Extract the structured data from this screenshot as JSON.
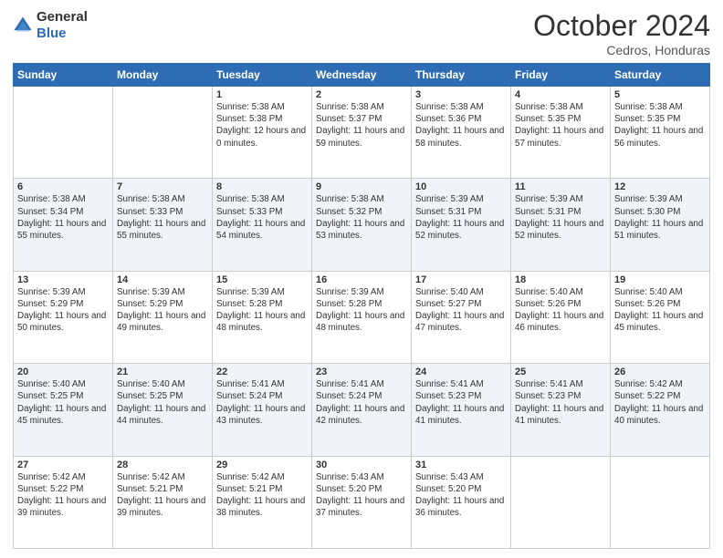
{
  "logo": {
    "general": "General",
    "blue": "Blue"
  },
  "header": {
    "month": "October 2024",
    "location": "Cedros, Honduras"
  },
  "days_of_week": [
    "Sunday",
    "Monday",
    "Tuesday",
    "Wednesday",
    "Thursday",
    "Friday",
    "Saturday"
  ],
  "weeks": [
    [
      {
        "day": null
      },
      {
        "day": null
      },
      {
        "day": "1",
        "sunrise": "Sunrise: 5:38 AM",
        "sunset": "Sunset: 5:38 PM",
        "daylight": "Daylight: 12 hours and 0 minutes."
      },
      {
        "day": "2",
        "sunrise": "Sunrise: 5:38 AM",
        "sunset": "Sunset: 5:37 PM",
        "daylight": "Daylight: 11 hours and 59 minutes."
      },
      {
        "day": "3",
        "sunrise": "Sunrise: 5:38 AM",
        "sunset": "Sunset: 5:36 PM",
        "daylight": "Daylight: 11 hours and 58 minutes."
      },
      {
        "day": "4",
        "sunrise": "Sunrise: 5:38 AM",
        "sunset": "Sunset: 5:35 PM",
        "daylight": "Daylight: 11 hours and 57 minutes."
      },
      {
        "day": "5",
        "sunrise": "Sunrise: 5:38 AM",
        "sunset": "Sunset: 5:35 PM",
        "daylight": "Daylight: 11 hours and 56 minutes."
      }
    ],
    [
      {
        "day": "6",
        "sunrise": "Sunrise: 5:38 AM",
        "sunset": "Sunset: 5:34 PM",
        "daylight": "Daylight: 11 hours and 55 minutes."
      },
      {
        "day": "7",
        "sunrise": "Sunrise: 5:38 AM",
        "sunset": "Sunset: 5:33 PM",
        "daylight": "Daylight: 11 hours and 55 minutes."
      },
      {
        "day": "8",
        "sunrise": "Sunrise: 5:38 AM",
        "sunset": "Sunset: 5:33 PM",
        "daylight": "Daylight: 11 hours and 54 minutes."
      },
      {
        "day": "9",
        "sunrise": "Sunrise: 5:38 AM",
        "sunset": "Sunset: 5:32 PM",
        "daylight": "Daylight: 11 hours and 53 minutes."
      },
      {
        "day": "10",
        "sunrise": "Sunrise: 5:39 AM",
        "sunset": "Sunset: 5:31 PM",
        "daylight": "Daylight: 11 hours and 52 minutes."
      },
      {
        "day": "11",
        "sunrise": "Sunrise: 5:39 AM",
        "sunset": "Sunset: 5:31 PM",
        "daylight": "Daylight: 11 hours and 52 minutes."
      },
      {
        "day": "12",
        "sunrise": "Sunrise: 5:39 AM",
        "sunset": "Sunset: 5:30 PM",
        "daylight": "Daylight: 11 hours and 51 minutes."
      }
    ],
    [
      {
        "day": "13",
        "sunrise": "Sunrise: 5:39 AM",
        "sunset": "Sunset: 5:29 PM",
        "daylight": "Daylight: 11 hours and 50 minutes."
      },
      {
        "day": "14",
        "sunrise": "Sunrise: 5:39 AM",
        "sunset": "Sunset: 5:29 PM",
        "daylight": "Daylight: 11 hours and 49 minutes."
      },
      {
        "day": "15",
        "sunrise": "Sunrise: 5:39 AM",
        "sunset": "Sunset: 5:28 PM",
        "daylight": "Daylight: 11 hours and 48 minutes."
      },
      {
        "day": "16",
        "sunrise": "Sunrise: 5:39 AM",
        "sunset": "Sunset: 5:28 PM",
        "daylight": "Daylight: 11 hours and 48 minutes."
      },
      {
        "day": "17",
        "sunrise": "Sunrise: 5:40 AM",
        "sunset": "Sunset: 5:27 PM",
        "daylight": "Daylight: 11 hours and 47 minutes."
      },
      {
        "day": "18",
        "sunrise": "Sunrise: 5:40 AM",
        "sunset": "Sunset: 5:26 PM",
        "daylight": "Daylight: 11 hours and 46 minutes."
      },
      {
        "day": "19",
        "sunrise": "Sunrise: 5:40 AM",
        "sunset": "Sunset: 5:26 PM",
        "daylight": "Daylight: 11 hours and 45 minutes."
      }
    ],
    [
      {
        "day": "20",
        "sunrise": "Sunrise: 5:40 AM",
        "sunset": "Sunset: 5:25 PM",
        "daylight": "Daylight: 11 hours and 45 minutes."
      },
      {
        "day": "21",
        "sunrise": "Sunrise: 5:40 AM",
        "sunset": "Sunset: 5:25 PM",
        "daylight": "Daylight: 11 hours and 44 minutes."
      },
      {
        "day": "22",
        "sunrise": "Sunrise: 5:41 AM",
        "sunset": "Sunset: 5:24 PM",
        "daylight": "Daylight: 11 hours and 43 minutes."
      },
      {
        "day": "23",
        "sunrise": "Sunrise: 5:41 AM",
        "sunset": "Sunset: 5:24 PM",
        "daylight": "Daylight: 11 hours and 42 minutes."
      },
      {
        "day": "24",
        "sunrise": "Sunrise: 5:41 AM",
        "sunset": "Sunset: 5:23 PM",
        "daylight": "Daylight: 11 hours and 41 minutes."
      },
      {
        "day": "25",
        "sunrise": "Sunrise: 5:41 AM",
        "sunset": "Sunset: 5:23 PM",
        "daylight": "Daylight: 11 hours and 41 minutes."
      },
      {
        "day": "26",
        "sunrise": "Sunrise: 5:42 AM",
        "sunset": "Sunset: 5:22 PM",
        "daylight": "Daylight: 11 hours and 40 minutes."
      }
    ],
    [
      {
        "day": "27",
        "sunrise": "Sunrise: 5:42 AM",
        "sunset": "Sunset: 5:22 PM",
        "daylight": "Daylight: 11 hours and 39 minutes."
      },
      {
        "day": "28",
        "sunrise": "Sunrise: 5:42 AM",
        "sunset": "Sunset: 5:21 PM",
        "daylight": "Daylight: 11 hours and 39 minutes."
      },
      {
        "day": "29",
        "sunrise": "Sunrise: 5:42 AM",
        "sunset": "Sunset: 5:21 PM",
        "daylight": "Daylight: 11 hours and 38 minutes."
      },
      {
        "day": "30",
        "sunrise": "Sunrise: 5:43 AM",
        "sunset": "Sunset: 5:20 PM",
        "daylight": "Daylight: 11 hours and 37 minutes."
      },
      {
        "day": "31",
        "sunrise": "Sunrise: 5:43 AM",
        "sunset": "Sunset: 5:20 PM",
        "daylight": "Daylight: 11 hours and 36 minutes."
      },
      {
        "day": null
      },
      {
        "day": null
      }
    ]
  ]
}
